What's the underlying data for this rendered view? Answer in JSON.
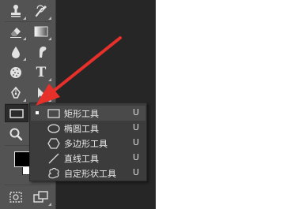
{
  "toolbar": {
    "tools": [
      {
        "name": "clone-stamp-tool",
        "icon": "stamp-icon"
      },
      {
        "name": "history-brush-tool",
        "icon": "history-brush-icon"
      },
      {
        "name": "eraser-tool",
        "icon": "eraser-icon"
      },
      {
        "name": "gradient-tool",
        "icon": "gradient-icon"
      },
      {
        "name": "blur-tool",
        "icon": "droplet-icon"
      },
      {
        "name": "smudge-tool",
        "icon": "smudge-finger-icon"
      },
      {
        "name": "sponge-tool",
        "icon": "sponge-icon"
      },
      {
        "name": "type-tool",
        "icon": "type-t-icon",
        "glyph": "T"
      },
      {
        "name": "pen-tool",
        "icon": "pen-icon"
      },
      {
        "name": "path-selection-tool",
        "icon": "arrow-cursor-icon"
      },
      {
        "name": "rectangle-tool",
        "icon": "rectangle-icon",
        "active": true
      },
      {
        "name": "zoom-tool",
        "icon": "magnifier-icon"
      }
    ],
    "foreground_color": "#000000",
    "background_color": "#ffffff"
  },
  "flyout": {
    "items": [
      {
        "label": "矩形工具",
        "shortcut": "U",
        "icon": "rectangle-icon",
        "selected": true
      },
      {
        "label": "椭圆工具",
        "shortcut": "U",
        "icon": "ellipse-icon",
        "selected": false
      },
      {
        "label": "多边形工具",
        "shortcut": "U",
        "icon": "polygon-icon",
        "selected": false
      },
      {
        "label": "直线工具",
        "shortcut": "U",
        "icon": "line-icon",
        "selected": false
      },
      {
        "label": "自定形状工具",
        "shortcut": "U",
        "icon": "custom-shape-icon",
        "selected": false
      }
    ]
  },
  "colors": {
    "toolbar_bg": "#535353",
    "canvas_bg": "#262626",
    "menu_bg": "#3c3c3c",
    "highlight_arrow": "#e8302a"
  }
}
